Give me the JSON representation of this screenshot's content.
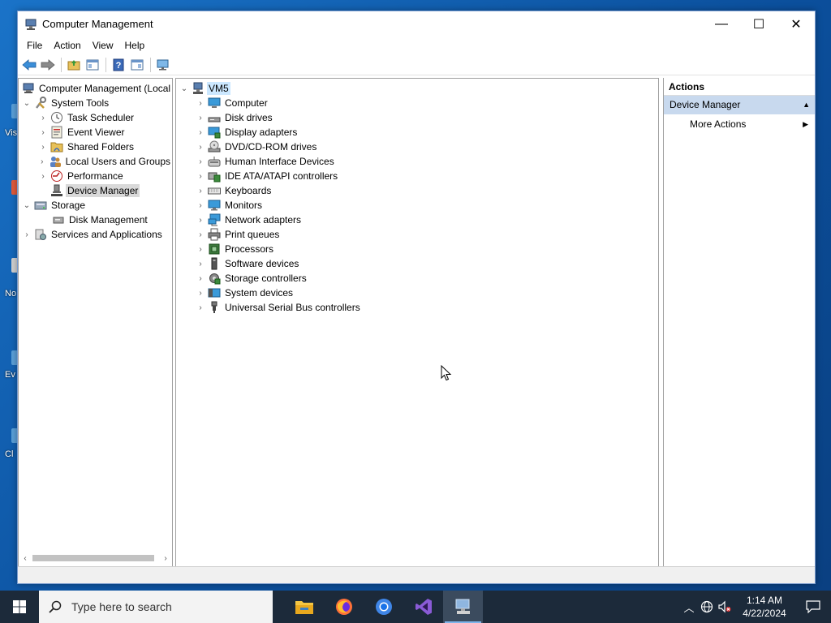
{
  "window": {
    "title": "Computer Management",
    "controls": {
      "minimize": "—",
      "maximize": "☐",
      "close": "✕"
    }
  },
  "menu": [
    "File",
    "Action",
    "View",
    "Help"
  ],
  "desktop_fragments": [
    "Vis",
    "No",
    "Ev",
    "Cl"
  ],
  "left_tree": {
    "root": "Computer Management (Local",
    "system_tools": "System Tools",
    "children": [
      {
        "label": "Task Scheduler",
        "icon": "clock-icon"
      },
      {
        "label": "Event Viewer",
        "icon": "event-viewer-icon"
      },
      {
        "label": "Shared Folders",
        "icon": "shared-folders-icon"
      },
      {
        "label": "Local Users and Groups",
        "icon": "users-icon"
      },
      {
        "label": "Performance",
        "icon": "performance-icon"
      },
      {
        "label": "Device Manager",
        "icon": "device-manager-icon"
      }
    ],
    "storage": "Storage",
    "disk_management": "Disk Management",
    "services": "Services and Applications"
  },
  "device_tree": {
    "root": "VM5",
    "categories": [
      {
        "label": "Computer",
        "icon": "computer-icon"
      },
      {
        "label": "Disk drives",
        "icon": "disk-drive-icon"
      },
      {
        "label": "Display adapters",
        "icon": "display-adapter-icon"
      },
      {
        "label": "DVD/CD-ROM drives",
        "icon": "dvd-icon"
      },
      {
        "label": "Human Interface Devices",
        "icon": "hid-icon"
      },
      {
        "label": "IDE ATA/ATAPI controllers",
        "icon": "ide-controller-icon"
      },
      {
        "label": "Keyboards",
        "icon": "keyboard-icon"
      },
      {
        "label": "Monitors",
        "icon": "monitor-icon"
      },
      {
        "label": "Network adapters",
        "icon": "network-adapter-icon"
      },
      {
        "label": "Print queues",
        "icon": "printer-icon"
      },
      {
        "label": "Processors",
        "icon": "processor-icon"
      },
      {
        "label": "Software devices",
        "icon": "software-device-icon"
      },
      {
        "label": "Storage controllers",
        "icon": "storage-controller-icon"
      },
      {
        "label": "System devices",
        "icon": "system-device-icon"
      },
      {
        "label": "Universal Serial Bus controllers",
        "icon": "usb-icon"
      }
    ]
  },
  "actions": {
    "header": "Actions",
    "group": "Device Manager",
    "item": "More Actions"
  },
  "taskbar": {
    "search_placeholder": "Type here to search",
    "time": "1:14 AM",
    "date": "4/22/2024"
  },
  "colors": {
    "selection_blue": "#cce8ff",
    "actions_group_bg": "#c8d9ee",
    "taskbar_bg": "#1c2a3a",
    "desktop_blue": "#1a73c8"
  }
}
